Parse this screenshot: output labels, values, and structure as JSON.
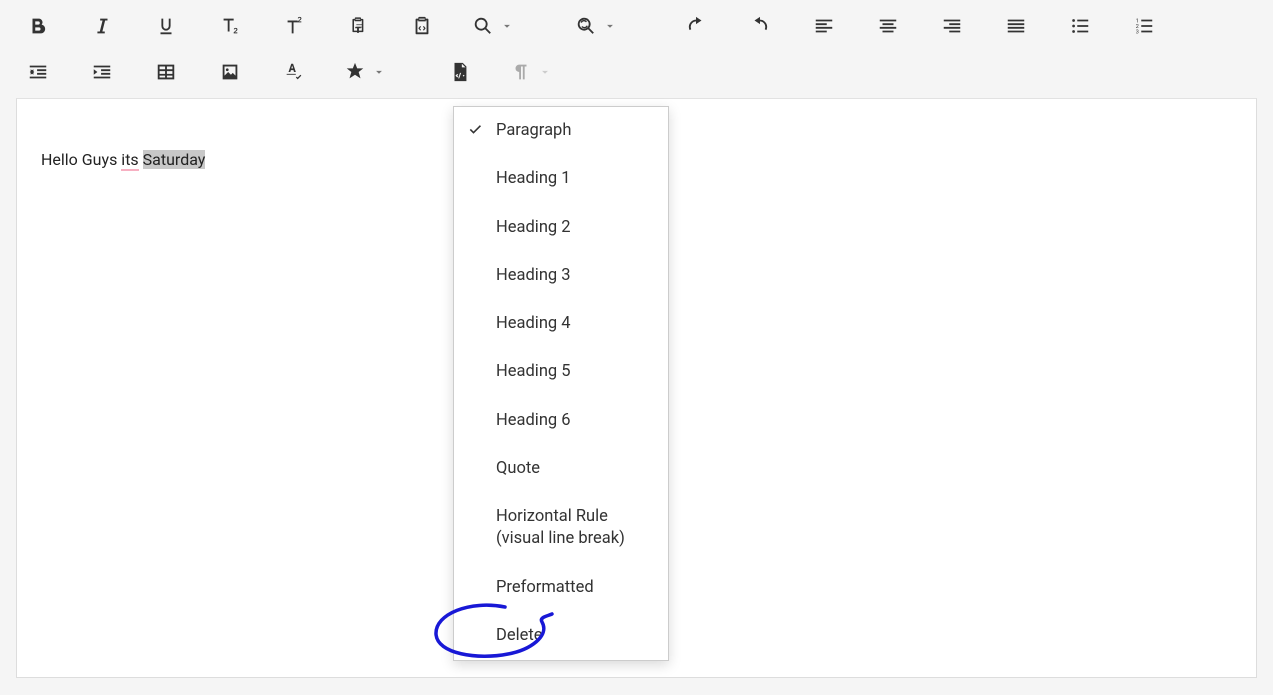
{
  "editor": {
    "text_before": "Hello Guys ",
    "text_spell": "its",
    "text_space": " ",
    "text_selected": "Saturday"
  },
  "dropdown": {
    "items": [
      {
        "label": "Paragraph",
        "checked": true
      },
      {
        "label": "Heading 1",
        "checked": false
      },
      {
        "label": "Heading 2",
        "checked": false
      },
      {
        "label": "Heading 3",
        "checked": false
      },
      {
        "label": "Heading 4",
        "checked": false
      },
      {
        "label": "Heading 5",
        "checked": false
      },
      {
        "label": "Heading 6",
        "checked": false
      },
      {
        "label": "Quote",
        "checked": false
      },
      {
        "label": "Horizontal Rule (visual line break)",
        "checked": false
      },
      {
        "label": "Preformatted",
        "checked": false
      },
      {
        "label": "Delete",
        "checked": false
      }
    ]
  },
  "toolbar": {
    "row1": [
      "bold",
      "italic",
      "underline",
      "subscript",
      "superscript",
      "paste-text",
      "paste-word",
      "find",
      "find-replace",
      "undo",
      "redo",
      "align-left",
      "align-center",
      "align-right",
      "justify",
      "bullet-list",
      "numbered-list"
    ],
    "row2": [
      "outdent",
      "indent",
      "table",
      "image",
      "spellcheck",
      "special",
      "code-paste",
      "paragraph-marks"
    ]
  }
}
